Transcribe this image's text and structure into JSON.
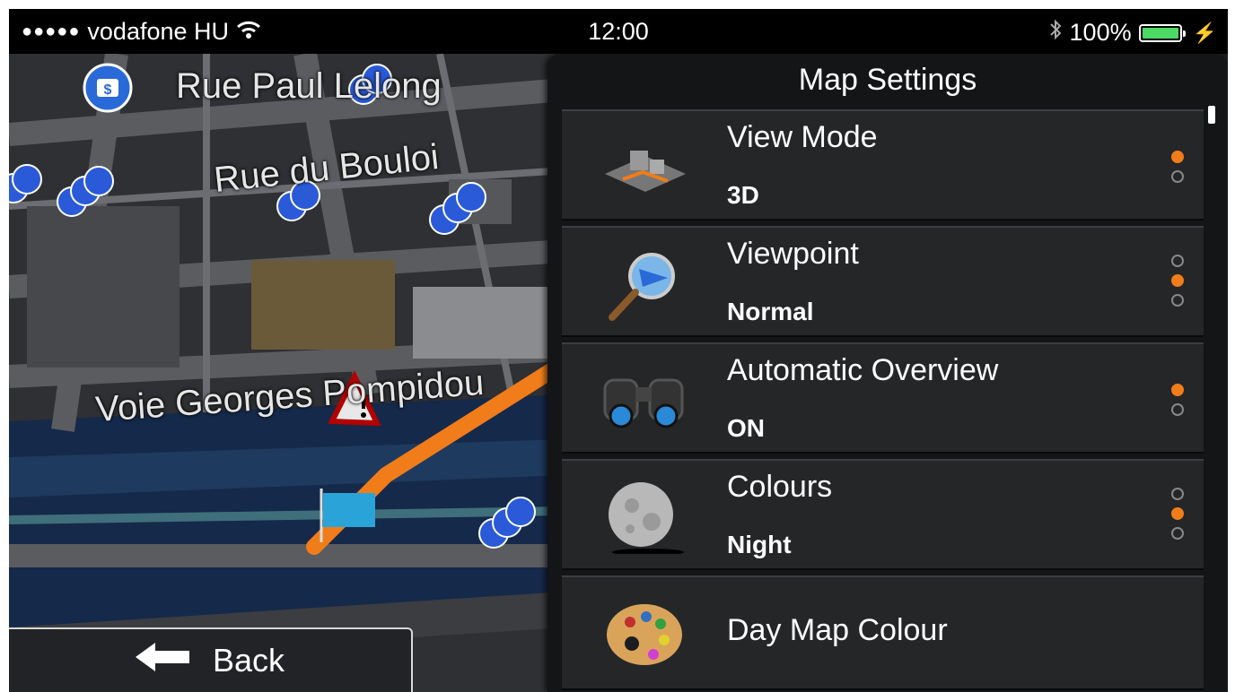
{
  "status_bar": {
    "signal": "●●●●●",
    "carrier": "vodafone HU",
    "time": "12:00",
    "battery": "100%",
    "battery_level": 1.0,
    "icons": [
      "wifi-icon",
      "bluetooth-icon",
      "battery-icon",
      "charging-icon"
    ]
  },
  "map": {
    "streets": [
      "Rue Paul Lelong",
      "Rue du Bouloi",
      "Voie Georges Pompidou"
    ],
    "back_label": "Back",
    "route_color": "#f07c1a"
  },
  "panel": {
    "title": "Map Settings",
    "items": [
      {
        "label": "View Mode",
        "value": "3D",
        "icon": "view-mode-icon",
        "options": 2,
        "selected": 0
      },
      {
        "label": "Viewpoint",
        "value": "Normal",
        "icon": "magnifier-icon",
        "options": 3,
        "selected": 1
      },
      {
        "label": "Automatic Overview",
        "value": "ON",
        "icon": "binoculars-icon",
        "options": 2,
        "selected": 0
      },
      {
        "label": "Colours",
        "value": "Night",
        "icon": "moon-icon",
        "options": 3,
        "selected": 1
      },
      {
        "label": "Day Map Colour",
        "icon": "palette-icon"
      }
    ]
  },
  "colors": {
    "accent": "#f07c1a",
    "battery": "#4cd964"
  }
}
